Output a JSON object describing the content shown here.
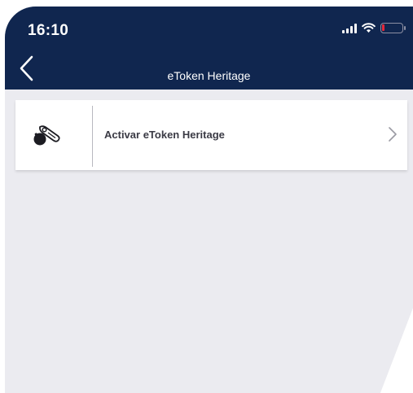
{
  "status_bar": {
    "time": "16:10",
    "icons": [
      "signal-icon",
      "wifi-icon",
      "battery-icon"
    ]
  },
  "nav_bar": {
    "title": "eToken Heritage",
    "back_icon": "chevron-left-icon"
  },
  "list": {
    "items": [
      {
        "label": "Activar eToken Heritage",
        "icon": "token-key-icon",
        "trailing_icon": "chevron-right-icon"
      }
    ]
  },
  "colors": {
    "header": "#10264f",
    "background": "#ebebf0",
    "card": "#ffffff",
    "battery_low": "#e5283a"
  }
}
